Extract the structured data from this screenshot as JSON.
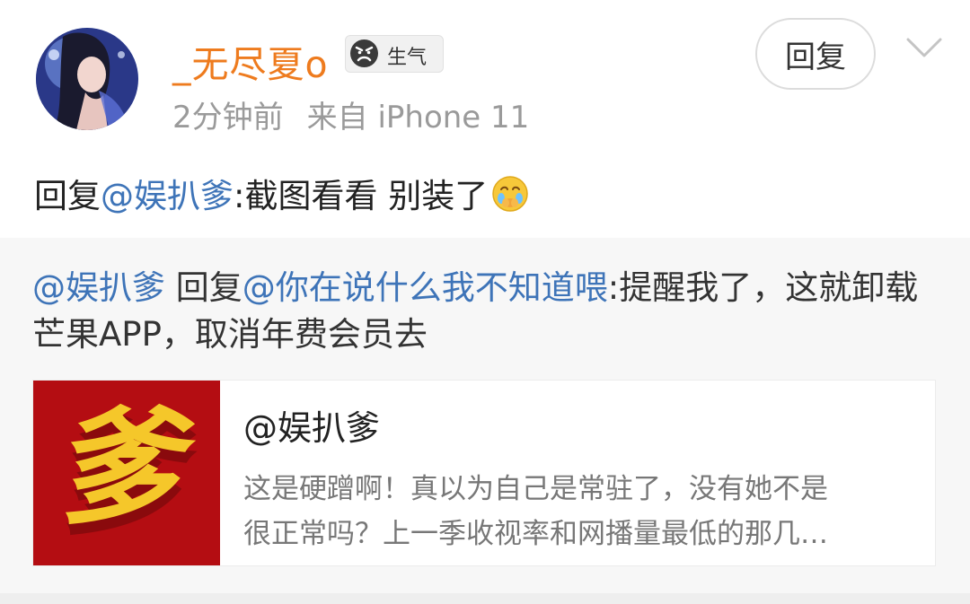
{
  "comment_header": {
    "username": "_无尽夏o",
    "mood_badge": {
      "icon": "angry-face-icon",
      "label": "生气"
    },
    "time": "2分钟前",
    "source": "来自 iPhone 11",
    "reply_button": "回复",
    "chevron_icon": "chevron-down-icon"
  },
  "comment": {
    "prefix": "回复",
    "mention": "@娱扒爹",
    "text": ":截图看看 别装了",
    "emoji": "crying-face-emoji"
  },
  "quoted_reply": {
    "author": "@娱扒爹",
    "reply_word": " 回复",
    "reply_to": "@你在说什么我不知道喂",
    "text": ":提醒我了，这就卸载芒果APP，取消年费会员去"
  },
  "linked_card": {
    "thumbnail_char": "爹",
    "title": "@娱扒爹",
    "desc_line1": "这是硬蹭啊！真以为自己是常驻了，没有她不是",
    "desc_line2": "很正常吗？上一季收视率和网播量最低的那几…"
  },
  "colors": {
    "username": "#ee7b1e",
    "mention": "#3e74b8",
    "thumb_bg": "#b40d12",
    "thumb_char": "#f5c72a"
  }
}
